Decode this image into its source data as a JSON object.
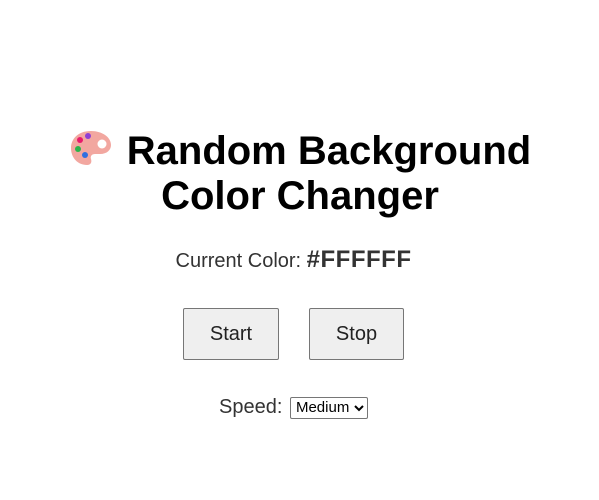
{
  "header": {
    "title": "Random Background Color Changer",
    "icon": "palette-icon"
  },
  "status": {
    "label": "Current Color:",
    "value": "#FFFFFF"
  },
  "controls": {
    "start_label": "Start",
    "stop_label": "Stop"
  },
  "speed": {
    "label": "Speed:",
    "selected": "Medium",
    "options": [
      "Medium"
    ]
  },
  "colors": {
    "background": "#FFFFFF",
    "button_bg": "#EFEFEF",
    "button_border": "#767676",
    "palette": "#F2A7A0"
  }
}
